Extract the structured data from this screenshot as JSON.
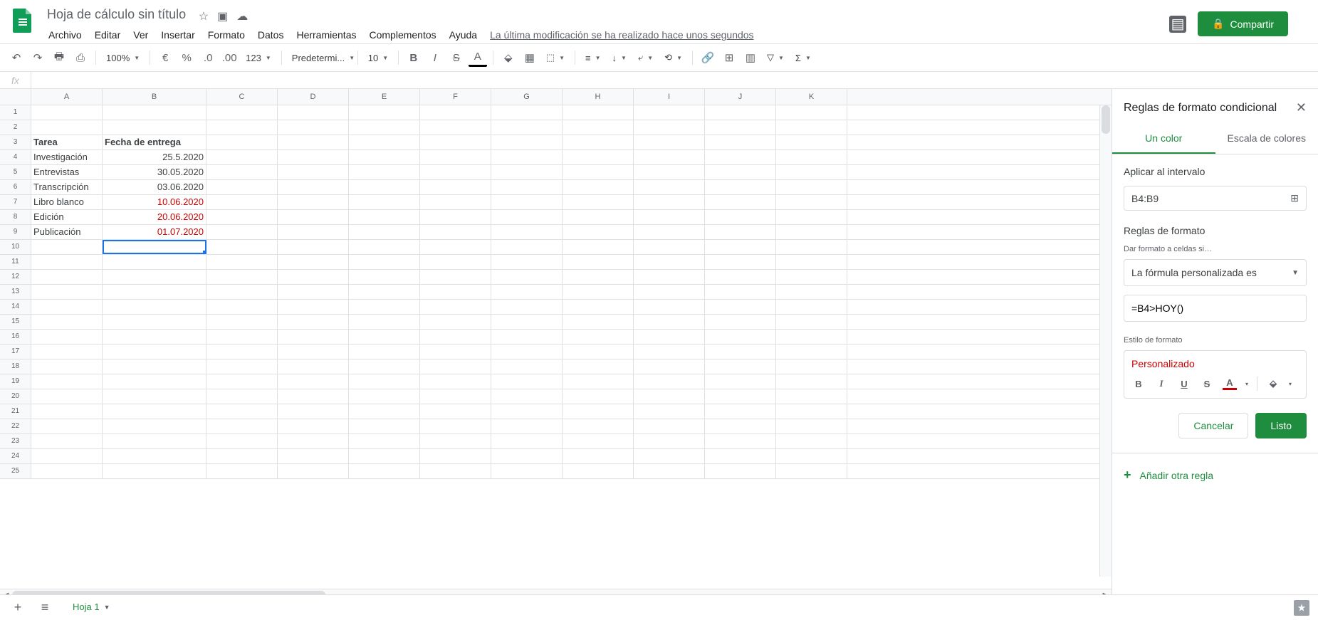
{
  "doc": {
    "title": "Hoja de cálculo sin título"
  },
  "menu": {
    "file": "Archivo",
    "edit": "Editar",
    "view": "Ver",
    "insert": "Insertar",
    "format": "Formato",
    "data": "Datos",
    "tools": "Herramientas",
    "addons": "Complementos",
    "help": "Ayuda",
    "lastmod": "La última modificación se ha realizado hace unos segundos"
  },
  "share": {
    "label": "Compartir"
  },
  "toolbar": {
    "zoom": "100%",
    "font": "Predetermi...",
    "size": "10",
    "num": "123"
  },
  "columns": [
    "A",
    "B",
    "C",
    "D",
    "E",
    "F",
    "G",
    "H",
    "I",
    "J",
    "K"
  ],
  "rows": [
    {
      "n": "1",
      "a": "",
      "b": ""
    },
    {
      "n": "2",
      "a": "",
      "b": ""
    },
    {
      "n": "3",
      "a": "Tarea",
      "b": "Fecha de entrega",
      "bold": true,
      "balign": "left"
    },
    {
      "n": "4",
      "a": "Investigación",
      "b": "25.5.2020",
      "balign": "right"
    },
    {
      "n": "5",
      "a": "Entrevistas",
      "b": "30.05.2020",
      "balign": "right"
    },
    {
      "n": "6",
      "a": "Transcripción",
      "b": "03.06.2020",
      "balign": "right"
    },
    {
      "n": "7",
      "a": "Libro blanco",
      "b": "10.06.2020",
      "balign": "right",
      "red": true
    },
    {
      "n": "8",
      "a": "Edición",
      "b": "20.06.2020",
      "balign": "right",
      "red": true
    },
    {
      "n": "9",
      "a": "Publicación",
      "b": "01.07.2020",
      "balign": "right",
      "red": true
    },
    {
      "n": "10",
      "a": "",
      "b": "",
      "selected": true
    },
    {
      "n": "11"
    },
    {
      "n": "12"
    },
    {
      "n": "13"
    },
    {
      "n": "14"
    },
    {
      "n": "15"
    },
    {
      "n": "16"
    },
    {
      "n": "17"
    },
    {
      "n": "18"
    },
    {
      "n": "19"
    },
    {
      "n": "20"
    },
    {
      "n": "21"
    },
    {
      "n": "22"
    },
    {
      "n": "23"
    },
    {
      "n": "24"
    },
    {
      "n": "25"
    }
  ],
  "sidepanel": {
    "title": "Reglas de formato condicional",
    "tab1": "Un color",
    "tab2": "Escala de colores",
    "apply_label": "Aplicar al intervalo",
    "range": "B4:B9",
    "rules_label": "Reglas de formato",
    "format_if": "Dar formato a celdas si…",
    "condition": "La fórmula personalizada es",
    "formula": "=B4>HOY()",
    "style_label": "Estilo de formato",
    "style_name": "Personalizado",
    "cancel": "Cancelar",
    "done": "Listo",
    "add_rule": "Añadir otra regla"
  },
  "footer": {
    "sheet": "Hoja 1"
  }
}
